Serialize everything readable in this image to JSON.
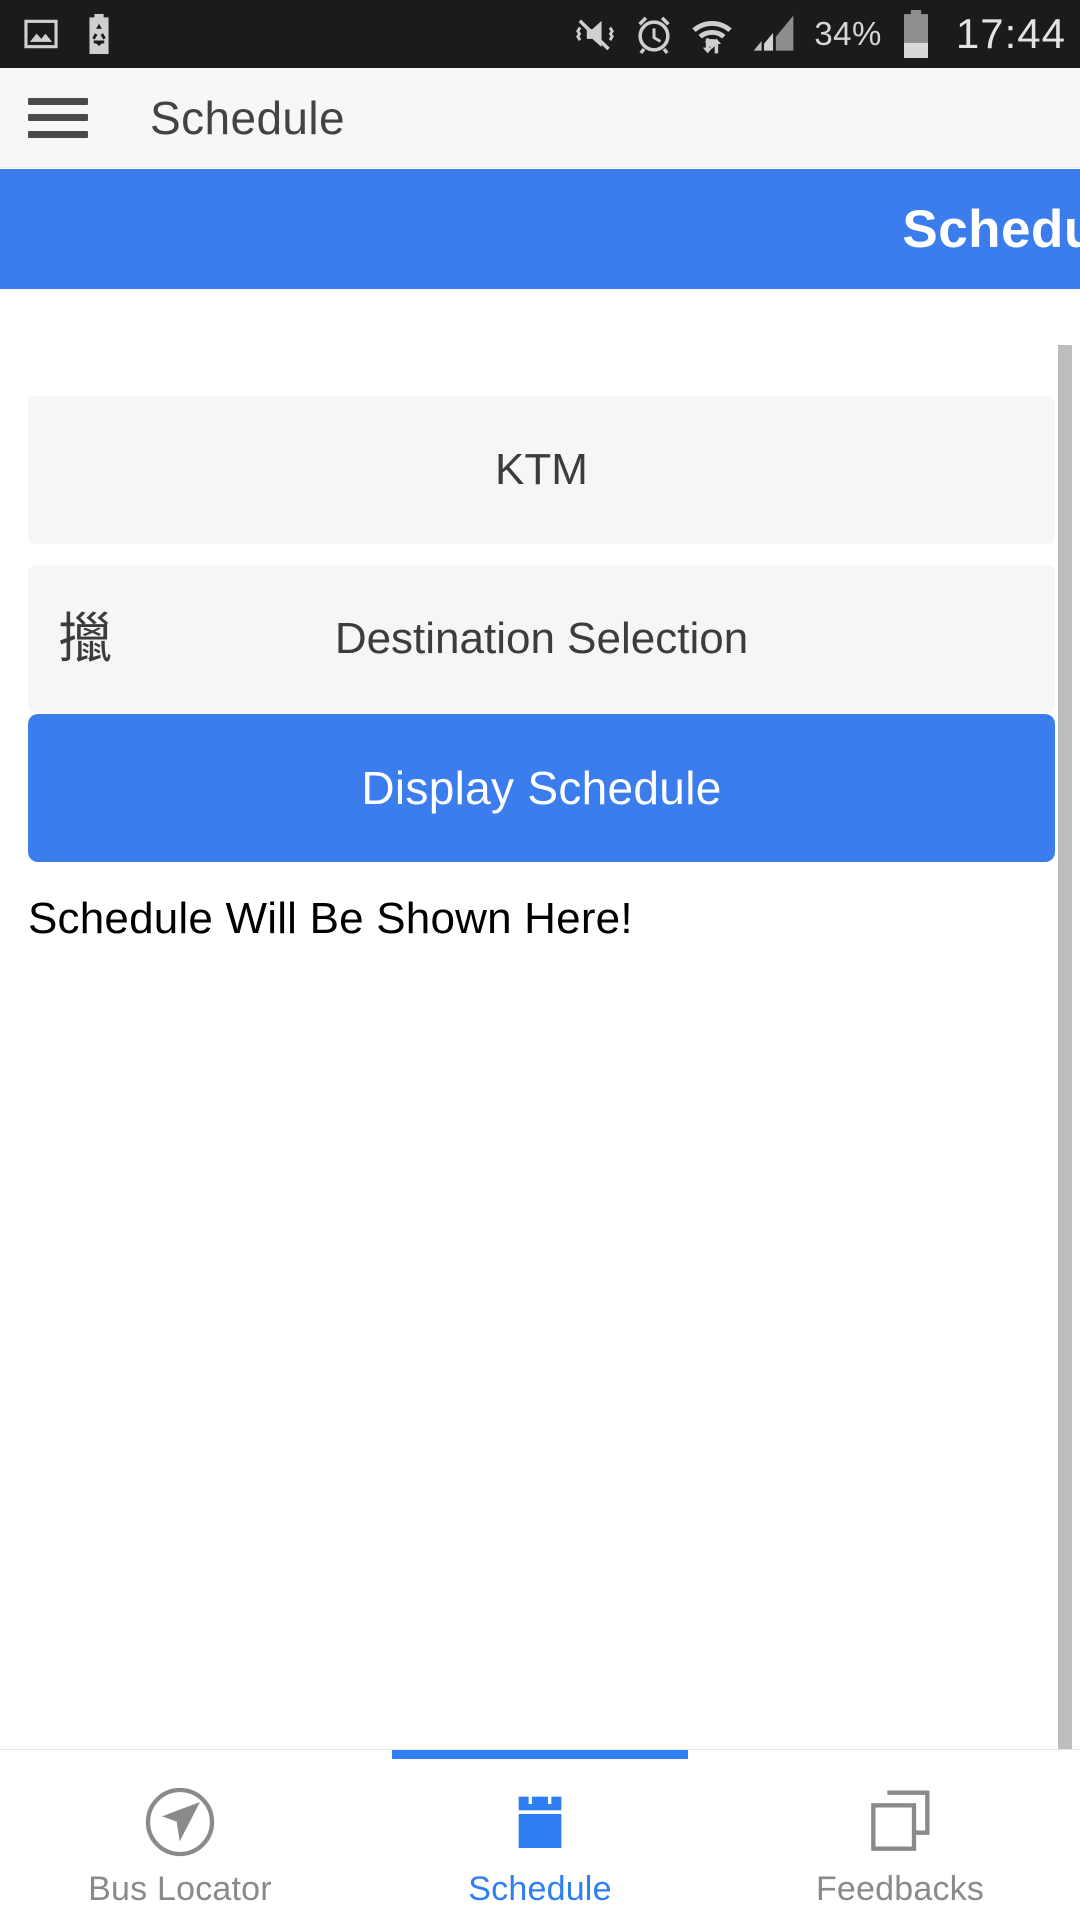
{
  "statusbar": {
    "left_icons": [
      "image-icon",
      "battery-saver-icon"
    ],
    "right_icons": [
      "vibrate-mute-icon",
      "alarm-clock-icon",
      "wifi-data-icon",
      "signal-bars-icon"
    ],
    "battery_percent": "34%",
    "battery_level": 34,
    "clock": "17:44",
    "background": "#1b1b1b"
  },
  "appbar": {
    "menu_icon": "hamburger-menu-icon",
    "title": "Schedule",
    "background": "#f7f7f7"
  },
  "banner": {
    "title": "Schedule",
    "background": "#3b7ded",
    "text_color": "#ffffff"
  },
  "form": {
    "origin": {
      "value": "KTM",
      "placeholder": "KTM"
    },
    "destination": {
      "glyph": "擸",
      "value": "Destination Selection",
      "placeholder": "Destination Selection"
    },
    "display_button": {
      "label": "Display Schedule",
      "color": "#3b7ded"
    },
    "result_text": "Schedule Will Be Shown Here!"
  },
  "scrollbar": {
    "thumb_color": "#bdbdbd"
  },
  "bottomnav": {
    "active_color": "#2f7ef2",
    "inactive_color": "#8a8a8a",
    "items": [
      {
        "label": "Bus Locator",
        "icon": "navigation-compass-icon",
        "active": false
      },
      {
        "label": "Schedule",
        "icon": "calendar-icon",
        "active": true
      },
      {
        "label": "Feedbacks",
        "icon": "copy-pages-icon",
        "active": false
      }
    ]
  }
}
